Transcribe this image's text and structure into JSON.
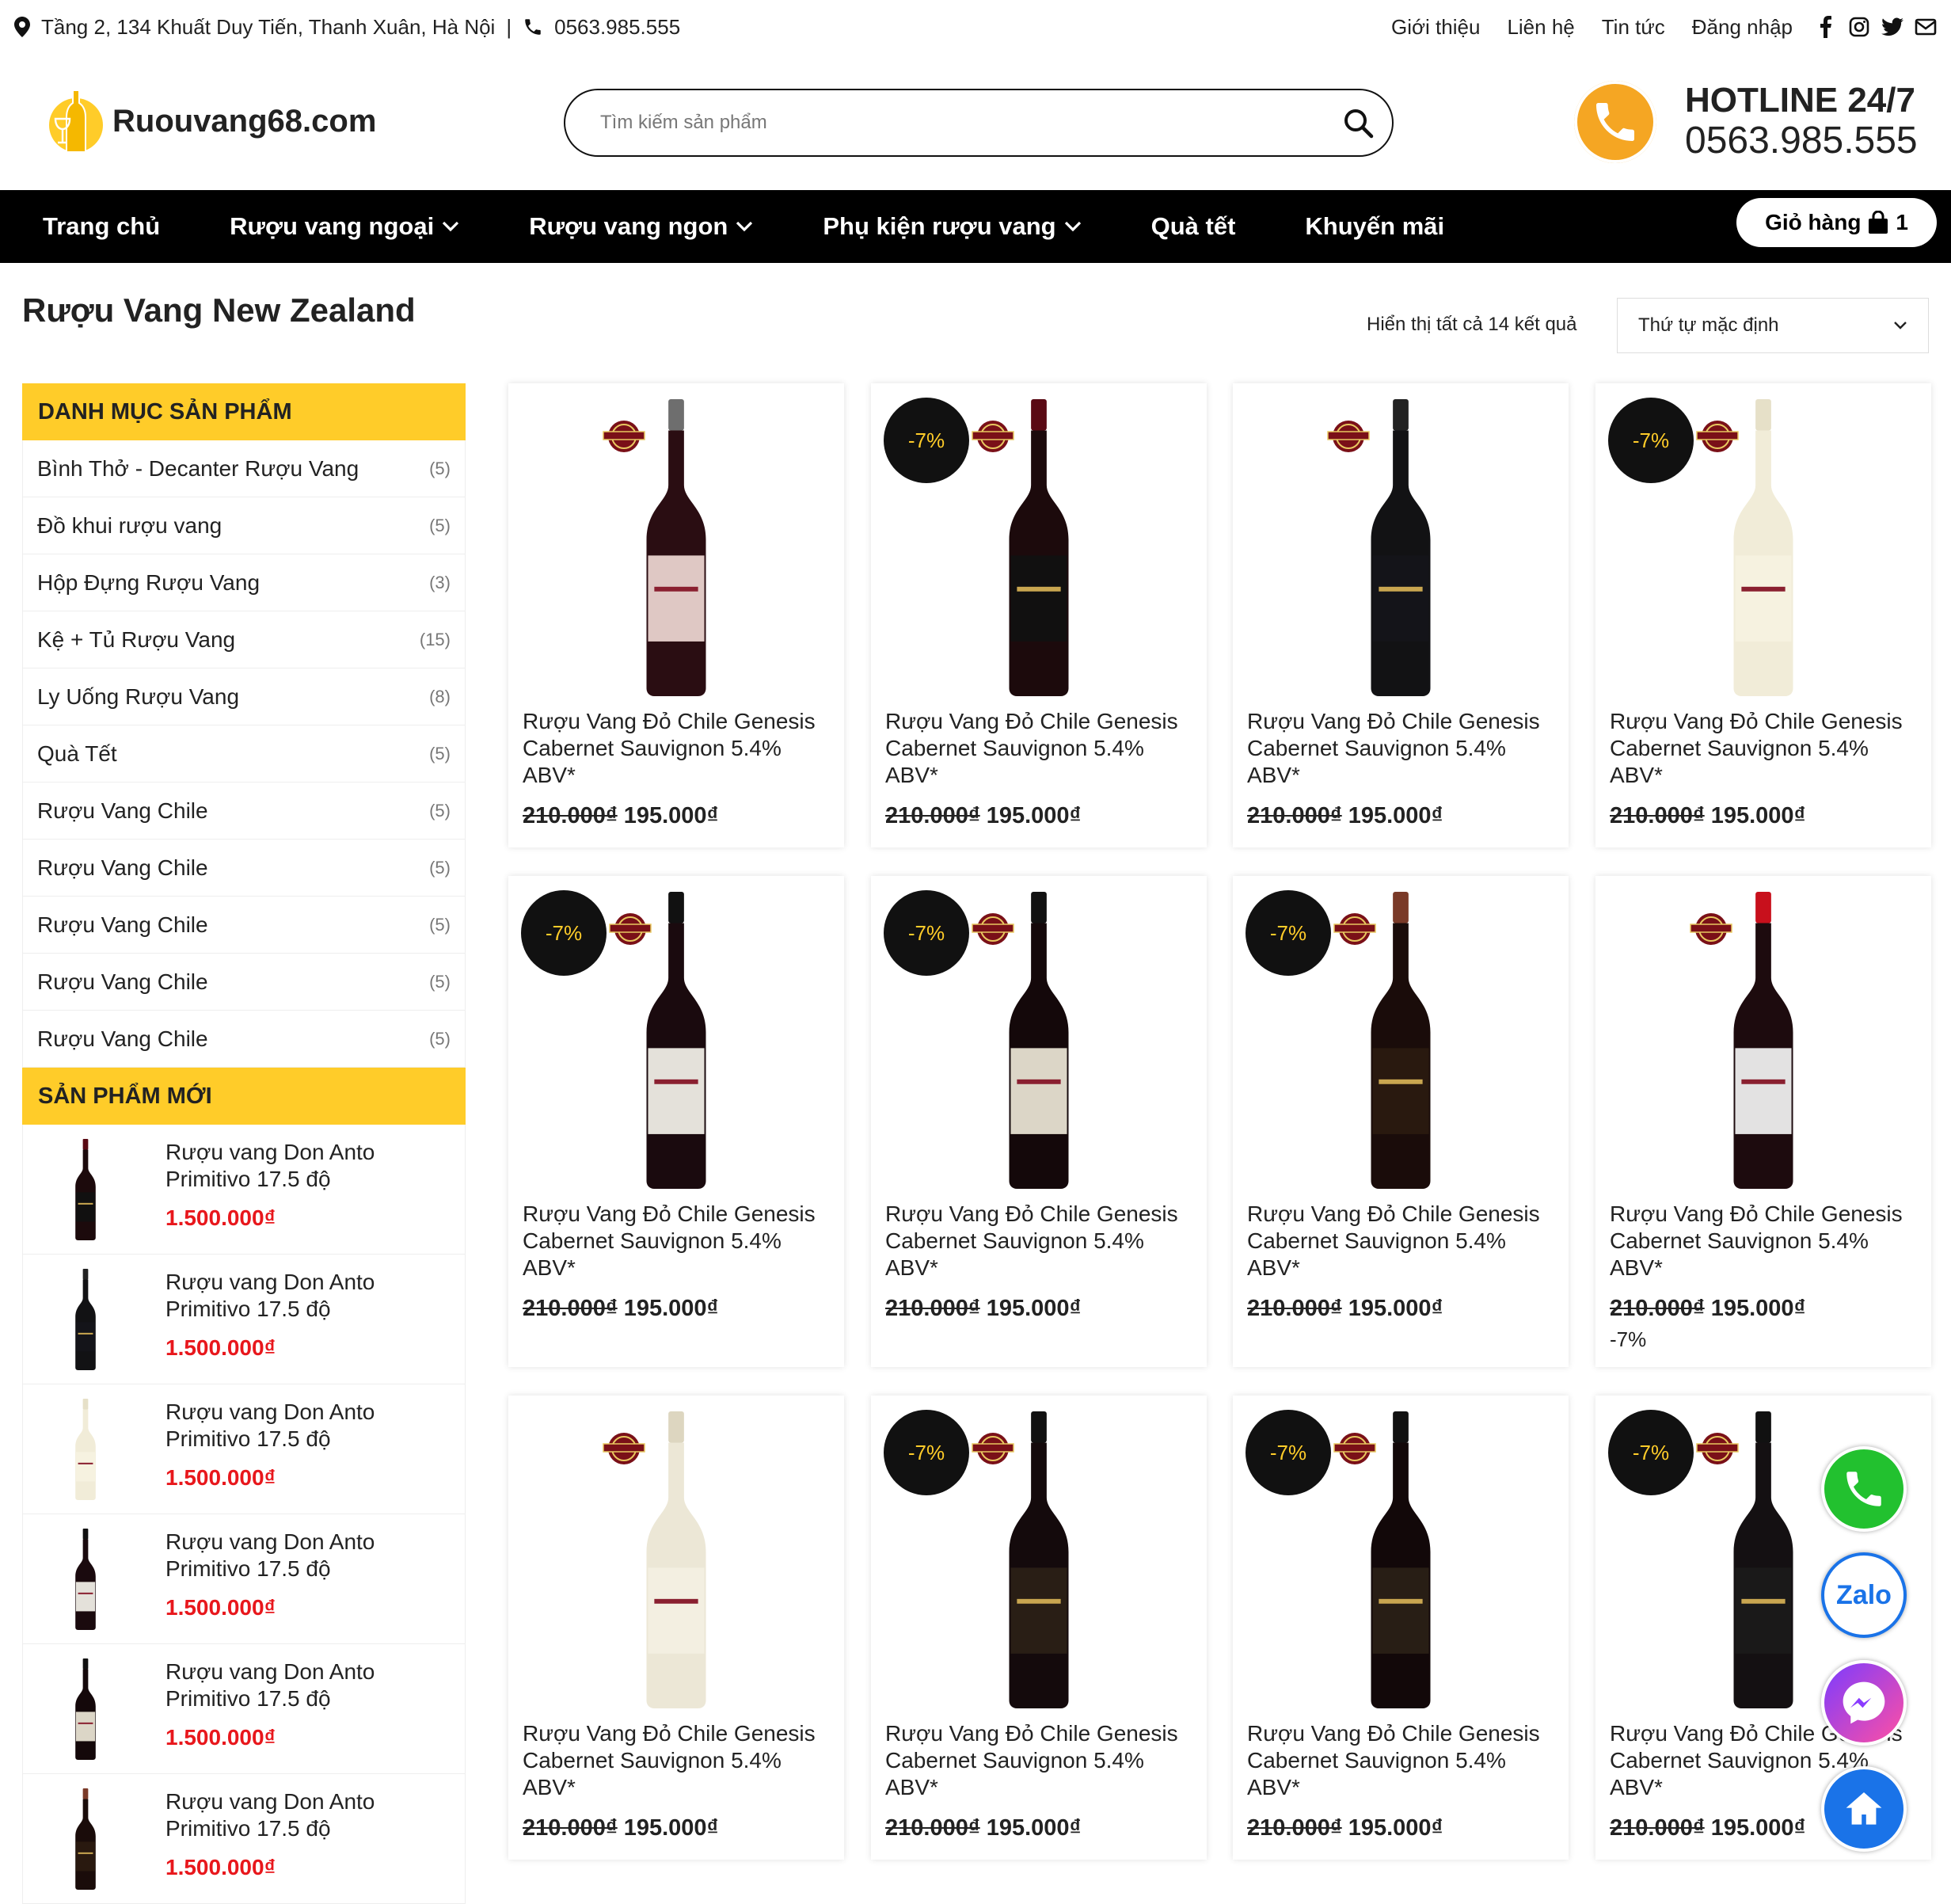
{
  "topbar": {
    "address": "Tầng 2, 134 Khuất Duy Tiến, Thanh Xuân, Hà Nội",
    "separator": "|",
    "phone": "0563.985.555",
    "links": [
      "Giới thiệu",
      "Liên hệ",
      "Tin tức",
      "Đăng nhập"
    ]
  },
  "header": {
    "logo_text": "Ruouvang68.com",
    "search_placeholder": "Tìm kiếm sản phẩm",
    "hotline_title": "HOTLINE 24/7",
    "hotline_number": "0563.985.555"
  },
  "nav": {
    "items": [
      "Trang chủ",
      "Rượu vang ngoại",
      "Rượu vang ngon",
      "Phụ kiện rượu vang",
      "Quà tết",
      "Khuyến mãi"
    ],
    "cart_label": "Giỏ hàng",
    "cart_count": "1"
  },
  "page": {
    "title": "Rượu Vang New Zealand",
    "result_count": "Hiển thị tất cả 14 kết quả",
    "sort_selected": "Thứ tự mặc định"
  },
  "sidebar": {
    "categories_title": "DANH MỤC SẢN PHẨM",
    "categories": [
      {
        "name": "Bình Thở - Decanter Rượu Vang",
        "count": "(5)"
      },
      {
        "name": "Đồ khui rượu vang",
        "count": "(5)"
      },
      {
        "name": "Hộp Đựng Rượu Vang",
        "count": "(3)"
      },
      {
        "name": "Kệ + Tủ Rượu Vang",
        "count": "(15)"
      },
      {
        "name": "Ly Uống Rượu Vang",
        "count": "(8)"
      },
      {
        "name": "Quà Tết",
        "count": "(5)"
      },
      {
        "name": "Rượu Vang Chile",
        "count": "(5)"
      },
      {
        "name": "Rượu Vang Chile",
        "count": "(5)"
      },
      {
        "name": "Rượu Vang Chile",
        "count": "(5)"
      },
      {
        "name": "Rượu Vang Chile",
        "count": "(5)"
      },
      {
        "name": "Rượu Vang Chile",
        "count": "(5)"
      }
    ],
    "new_title": "SẢN PHẨM MỚI",
    "new_products": [
      {
        "name": "Rượu vang Don Anto Primitivo 17.5 độ",
        "price": "1.500.000₫"
      },
      {
        "name": "Rượu vang Don Anto Primitivo 17.5 độ",
        "price": "1.500.000₫"
      },
      {
        "name": "Rượu vang Don Anto Primitivo 17.5 độ",
        "price": "1.500.000₫"
      },
      {
        "name": "Rượu vang Don Anto Primitivo 17.5 độ",
        "price": "1.500.000₫"
      },
      {
        "name": "Rượu vang Don Anto Primitivo 17.5 độ",
        "price": "1.500.000₫"
      },
      {
        "name": "Rượu vang Don Anto Primitivo 17.5 độ",
        "price": "1.500.000₫"
      }
    ]
  },
  "products": [
    {
      "name": "Rượu Vang Đỏ Chile Genesis Cabernet Sauvignon 5.4% ABV*",
      "old_price": "210.000₫",
      "price": "195.000₫",
      "badge": "",
      "extra": ""
    },
    {
      "name": "Rượu Vang Đỏ Chile Genesis Cabernet Sauvignon 5.4% ABV*",
      "old_price": "210.000₫",
      "price": "195.000₫",
      "badge": "-7%",
      "extra": ""
    },
    {
      "name": "Rượu Vang Đỏ Chile Genesis Cabernet Sauvignon 5.4% ABV*",
      "old_price": "210.000₫",
      "price": "195.000₫",
      "badge": "",
      "extra": ""
    },
    {
      "name": "Rượu Vang Đỏ Chile Genesis Cabernet Sauvignon 5.4% ABV*",
      "old_price": "210.000₫",
      "price": "195.000₫",
      "badge": "-7%",
      "extra": ""
    },
    {
      "name": "Rượu Vang Đỏ Chile Genesis Cabernet Sauvignon 5.4% ABV*",
      "old_price": "210.000₫",
      "price": "195.000₫",
      "badge": "-7%",
      "extra": ""
    },
    {
      "name": "Rượu Vang Đỏ Chile Genesis Cabernet Sauvignon 5.4% ABV*",
      "old_price": "210.000₫",
      "price": "195.000₫",
      "badge": "-7%",
      "extra": ""
    },
    {
      "name": "Rượu Vang Đỏ Chile Genesis Cabernet Sauvignon 5.4% ABV*",
      "old_price": "210.000₫",
      "price": "195.000₫",
      "badge": "-7%",
      "extra": ""
    },
    {
      "name": "Rượu Vang Đỏ Chile Genesis Cabernet Sauvignon 5.4% ABV*",
      "old_price": "210.000₫",
      "price": "195.000₫",
      "badge": "",
      "extra": "-7%"
    },
    {
      "name": "Rượu Vang Đỏ Chile Genesis Cabernet Sauvignon 5.4% ABV*",
      "old_price": "210.000₫",
      "price": "195.000₫",
      "badge": "",
      "extra": ""
    },
    {
      "name": "Rượu Vang Đỏ Chile Genesis Cabernet Sauvignon 5.4% ABV*",
      "old_price": "210.000₫",
      "price": "195.000₫",
      "badge": "-7%",
      "extra": ""
    },
    {
      "name": "Rượu Vang Đỏ Chile Genesis Cabernet Sauvignon 5.4% ABV*",
      "old_price": "210.000₫",
      "price": "195.000₫",
      "badge": "-7%",
      "extra": ""
    },
    {
      "name": "Rượu Vang Đỏ Chile Genesis Cabernet Sauvignon 5.4% ABV*",
      "old_price": "210.000₫",
      "price": "195.000₫",
      "badge": "-7%",
      "extra": ""
    }
  ],
  "floating": {
    "zalo_label": "Zalo",
    "icons": [
      "phone-icon",
      "zalo-icon",
      "messenger-icon",
      "home-icon"
    ]
  },
  "colors": {
    "accent_yellow": "#ffcc29",
    "hotline_orange": "#f5a623",
    "price_red": "#e8171c",
    "nav_black": "#000000",
    "badge_black": "#111111"
  }
}
